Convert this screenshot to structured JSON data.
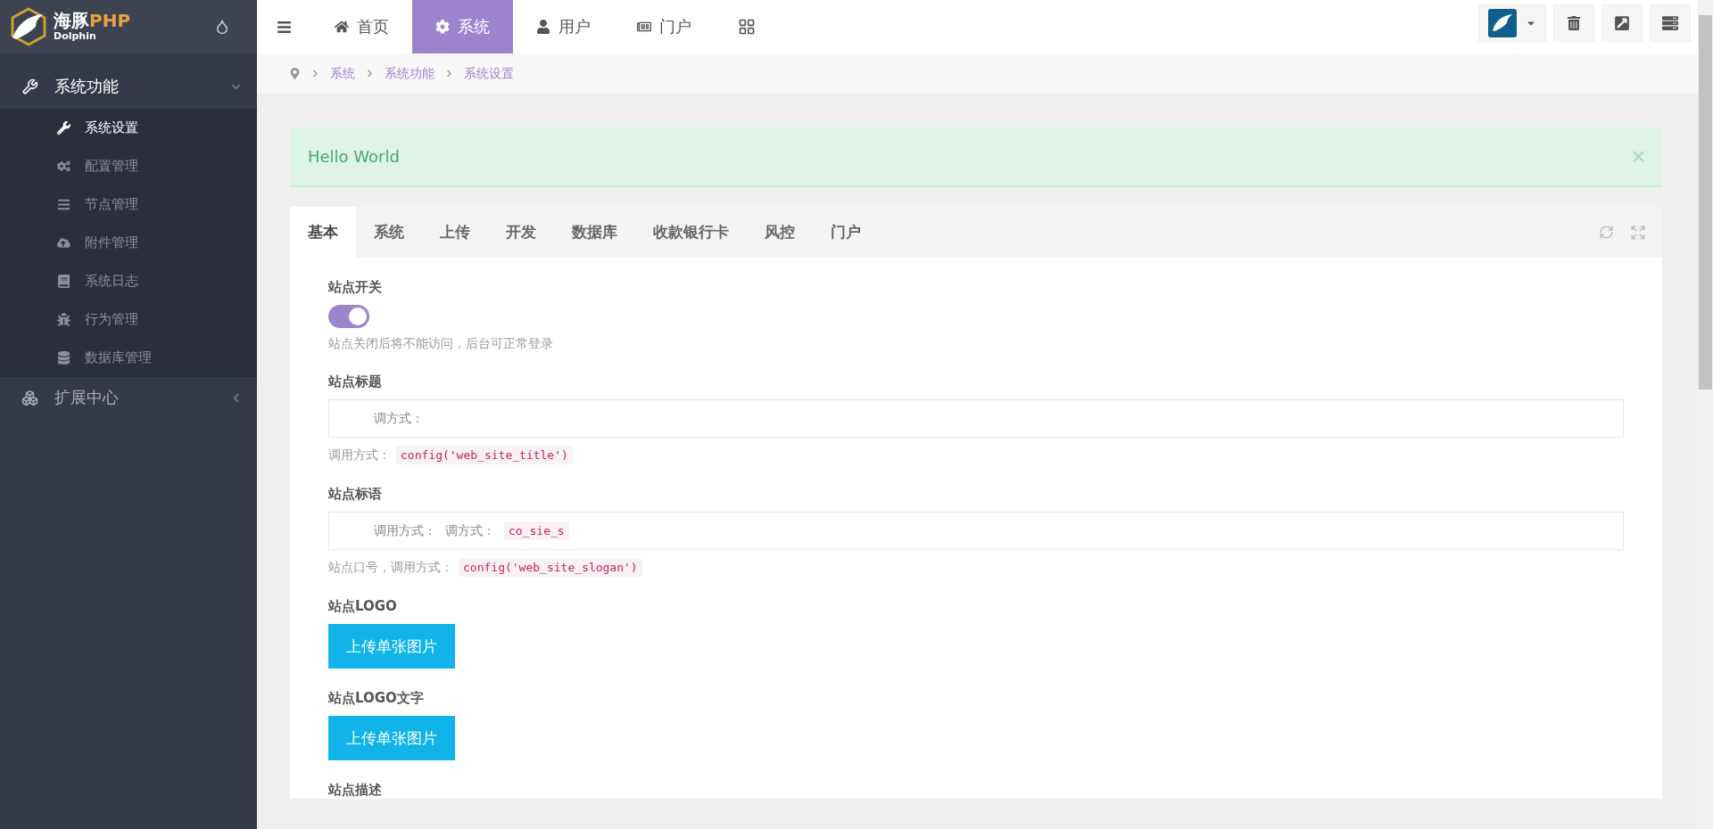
{
  "sidebar": {
    "logo": {
      "name": "海豚",
      "accent": "PHP",
      "subtitle": "Dolphin"
    },
    "groups": [
      {
        "label": "系统功能",
        "expanded": true,
        "items": [
          {
            "label": "系统设置",
            "selected": true
          },
          {
            "label": "配置管理",
            "selected": false
          },
          {
            "label": "节点管理",
            "selected": false
          },
          {
            "label": "附件管理",
            "selected": false
          },
          {
            "label": "系统日志",
            "selected": false
          },
          {
            "label": "行为管理",
            "selected": false
          },
          {
            "label": "数据库管理",
            "selected": false
          }
        ]
      },
      {
        "label": "扩展中心",
        "expanded": false
      }
    ]
  },
  "topnav": [
    {
      "label": "首页",
      "selected": false
    },
    {
      "label": "系统",
      "selected": true
    },
    {
      "label": "用户",
      "selected": false
    },
    {
      "label": "门户",
      "selected": false
    }
  ],
  "breadcrumb": [
    "系统",
    "系统功能",
    "系统设置"
  ],
  "alert": {
    "text": "Hello World"
  },
  "tabs": [
    {
      "label": "基本",
      "selected": true
    },
    {
      "label": "系统",
      "selected": false
    },
    {
      "label": "上传",
      "selected": false
    },
    {
      "label": "开发",
      "selected": false
    },
    {
      "label": "数据库",
      "selected": false
    },
    {
      "label": "收款银行卡",
      "selected": false
    },
    {
      "label": "风控",
      "selected": false
    },
    {
      "label": "门户",
      "selected": false
    }
  ],
  "fields": [
    {
      "kind": "switch",
      "label": "站点开关",
      "on": true,
      "help": "站点关闭后将不能访问，后台可正常登录"
    },
    {
      "kind": "text",
      "label": "站点标题",
      "value": [
        "调方式："
      ],
      "help": "调用方式：",
      "help_code": "config('web_site_title')"
    },
    {
      "kind": "text",
      "label": "站点标语",
      "value": [
        "调用方式：",
        "调方式："
      ],
      "value_code": "co_sie_s",
      "help": "站点口号，调用方式：",
      "help_code": "config('web_site_slogan')"
    },
    {
      "kind": "upload",
      "label": "站点LOGO",
      "button": "上传单张图片"
    },
    {
      "kind": "upload",
      "label": "站点LOGO文字",
      "button": "上传单张图片"
    },
    {
      "kind": "heading",
      "label": "站点描述"
    }
  ]
}
